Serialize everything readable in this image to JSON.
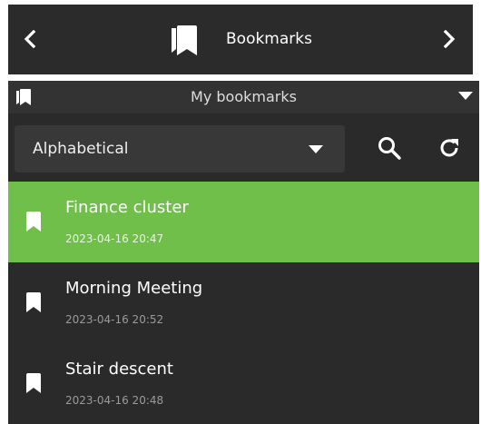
{
  "header": {
    "title": "Bookmarks",
    "prev_icon": "chevron-left-icon",
    "next_icon": "chevron-right-icon",
    "title_icon": "bookmarks-icon"
  },
  "panel": {
    "title": "My bookmarks",
    "sort": {
      "selected": "Alphabetical"
    },
    "bookmarks": [
      {
        "name": "Finance cluster",
        "date": "2023-04-16 20:47",
        "selected": true
      },
      {
        "name": "Morning Meeting",
        "date": "2023-04-16 20:52",
        "selected": false
      },
      {
        "name": "Stair descent",
        "date": "2023-04-16 20:48",
        "selected": false
      }
    ]
  },
  "colors": {
    "selected_row": "#6fbf4a",
    "panel_bg": "#2a2a2a",
    "topbar_bg": "#2b2b2b"
  }
}
